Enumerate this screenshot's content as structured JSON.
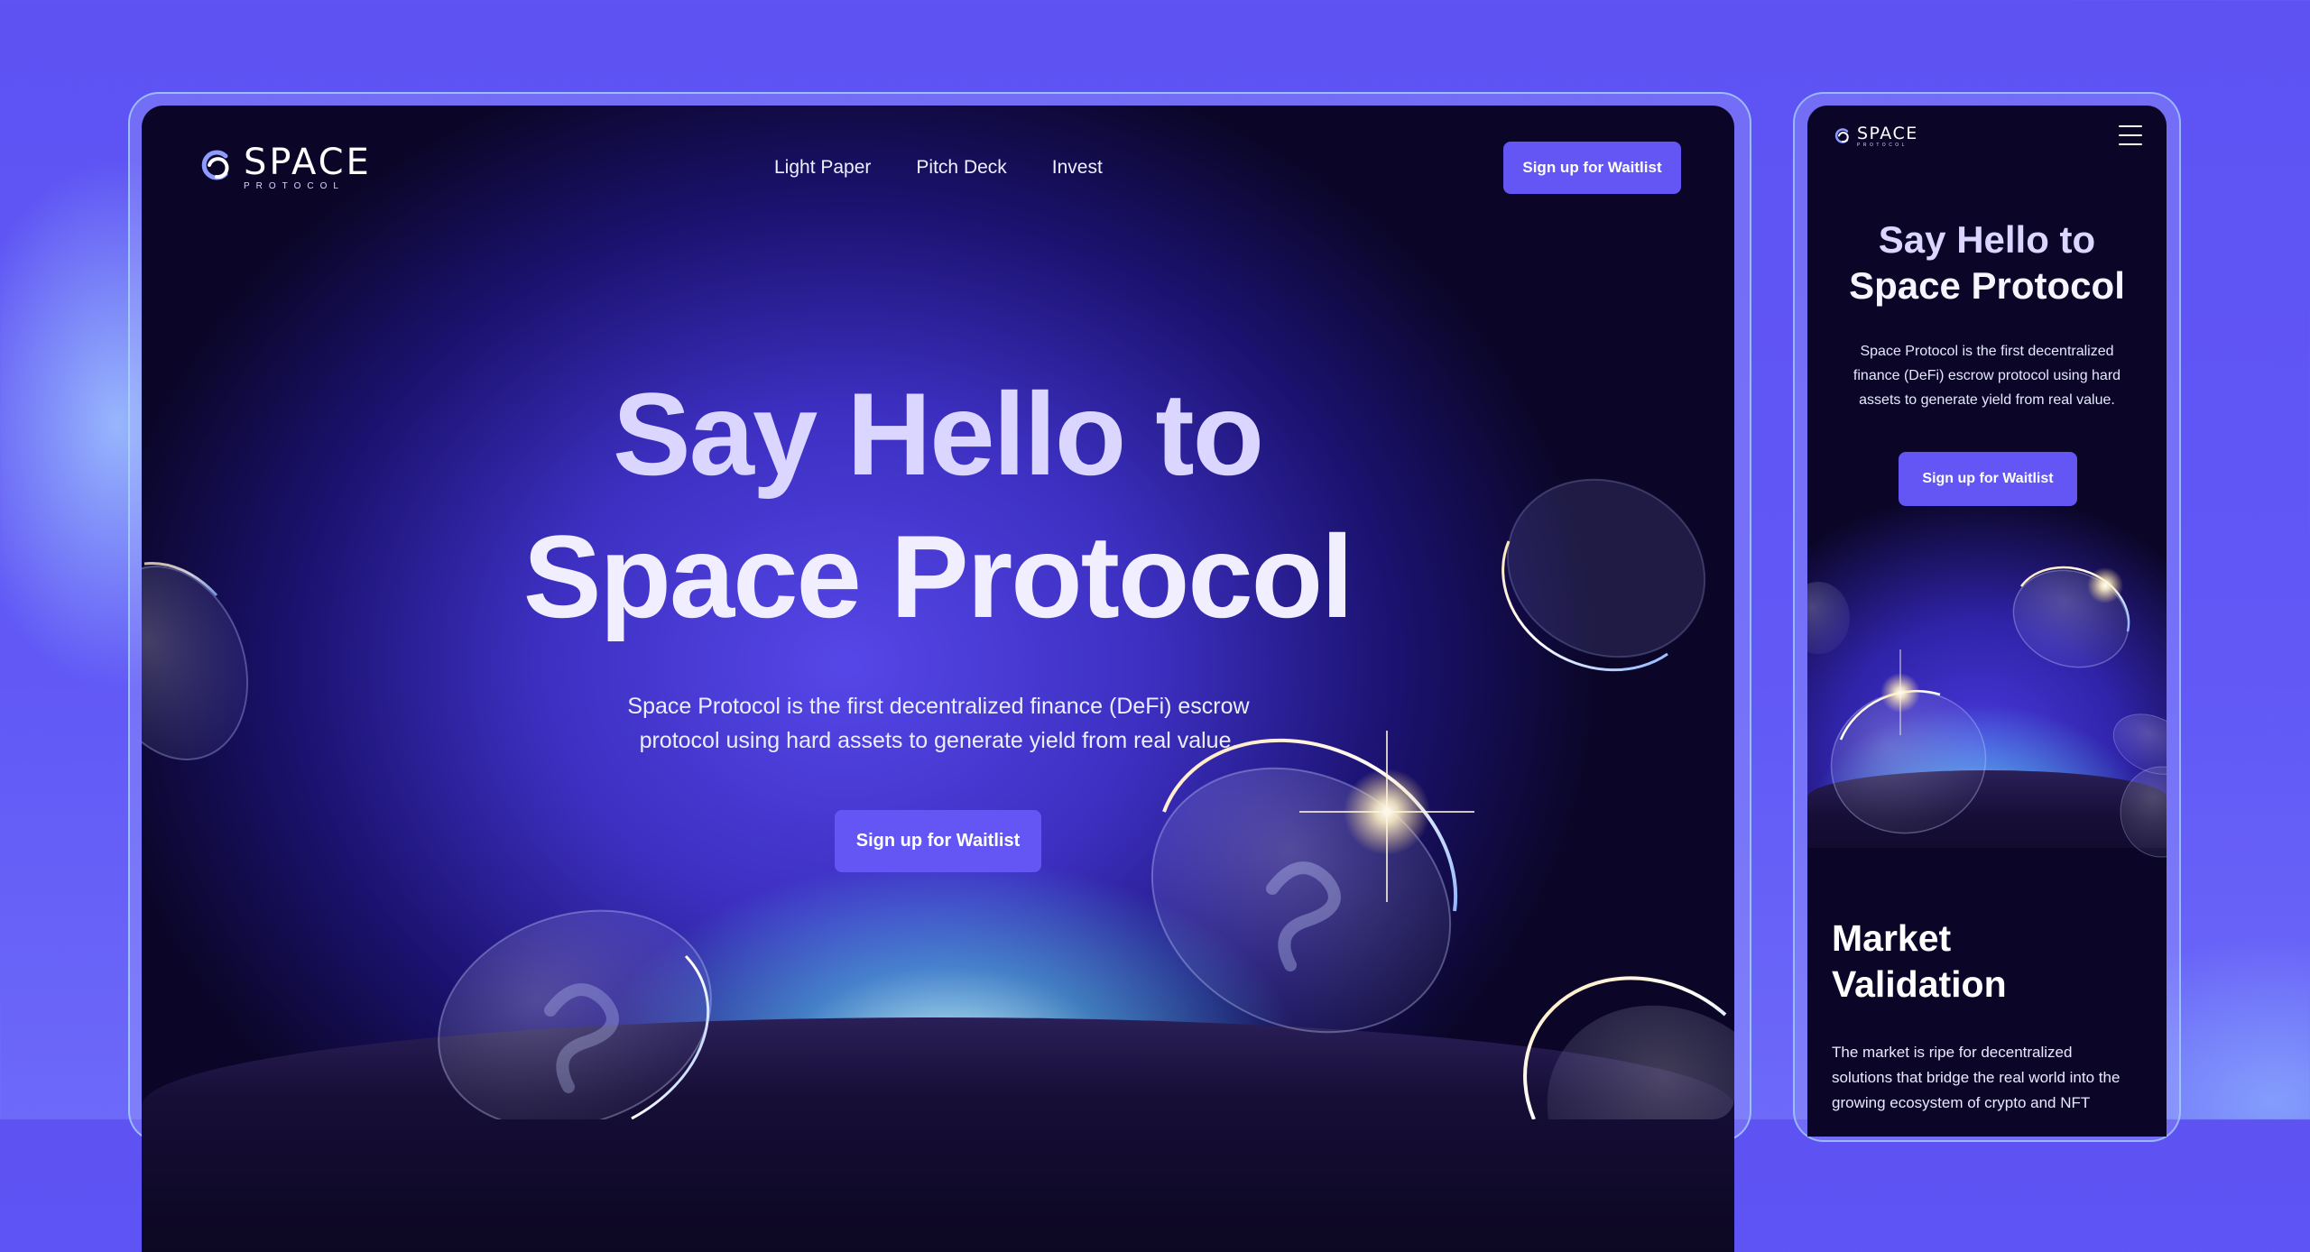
{
  "brand": {
    "name": "SPACE",
    "tagline": "PROTOCOL"
  },
  "desktop": {
    "nav": {
      "links": [
        "Light Paper",
        "Pitch Deck",
        "Invest"
      ],
      "cta": "Sign up for Waitlist"
    },
    "hero": {
      "title_line1": "Say Hello to",
      "title_line2": "Space Protocol",
      "subtitle_line1": "Space Protocol is the first decentralized finance (DeFi) escrow",
      "subtitle_line2": "protocol using hard assets to generate yield from real value.",
      "cta": "Sign up for Waitlist"
    }
  },
  "mobile": {
    "hero": {
      "title_line1": "Say Hello to",
      "title_line2": "Space Protocol",
      "subtitle_line1": "Space Protocol is the first decentralized",
      "subtitle_line2": "finance (DeFi) escrow protocol using hard",
      "subtitle_line3": "assets to generate yield from real value.",
      "cta": "Sign up for Waitlist"
    },
    "section": {
      "title_line1": "Market",
      "title_line2": "Validation",
      "body_line1": "The market is ripe for decentralized",
      "body_line2": "solutions that bridge the real world into the",
      "body_line3": "growing ecosystem of crypto and NFT"
    }
  },
  "colors": {
    "background": "#6158f6",
    "accent": "#6356f5",
    "screen": "#0b0628",
    "headline": "#e8e6ff"
  },
  "icons": {
    "logo": "space-protocol-logo-icon",
    "menu": "hamburger-menu-icon"
  }
}
